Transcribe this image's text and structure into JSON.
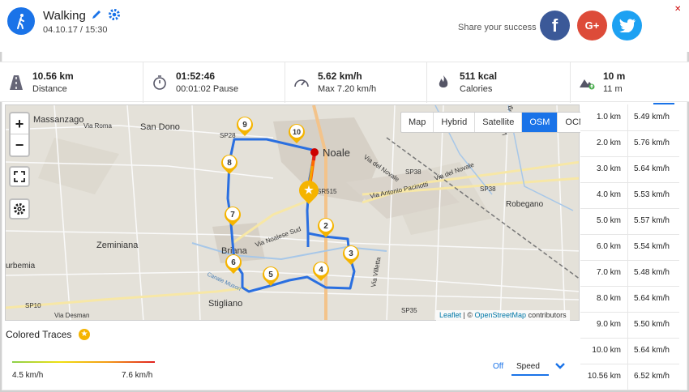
{
  "header": {
    "activity": "Walking",
    "datetime": "04.10.17 / 15:30",
    "share_label": "Share your success",
    "social": {
      "facebook": "f",
      "google": "G+",
      "twitter": "twitter-icon"
    }
  },
  "stats": [
    {
      "value": "10.56 km",
      "label": "Distance",
      "icon": "road-icon"
    },
    {
      "value": "01:52:46",
      "label": "00:01:02 Pause",
      "icon": "stopwatch-icon"
    },
    {
      "value": "5.62 km/h",
      "label": "Max 7.20 km/h",
      "icon": "speedometer-icon"
    },
    {
      "value": "511 kcal",
      "label": "Calories",
      "icon": "flame-icon"
    },
    {
      "value": "10 m",
      "label": "11 m",
      "icon": "mountain-icon"
    }
  ],
  "map": {
    "zoom_in": "+",
    "zoom_out": "−",
    "layers": [
      "Map",
      "Hybrid",
      "Satellite",
      "OSM",
      "OCM"
    ],
    "active_layer": "OSM",
    "attribution": {
      "leaflet": "Leaflet",
      "sep": " | © ",
      "osm": "OpenStreetMap",
      "tail": " contributors"
    },
    "places": [
      "Massanzago",
      "Via Roma",
      "San Dono",
      "SP28",
      "Noale",
      "Via del Novale",
      "SP38",
      "Via del Novale",
      "Via Antonio Pacinotti",
      "SP38",
      "SR515",
      "Robegano",
      "Zeminiana",
      "Briana",
      "Via Noalese Sud",
      "Canale Muson",
      "Stigliano",
      "SP10",
      "Via Desman",
      "SP35",
      "Via Valsugana",
      "Via Villetta",
      "urbemia"
    ],
    "markers": [
      "2",
      "3",
      "4",
      "5",
      "6",
      "7",
      "8",
      "9",
      "10"
    ]
  },
  "traces": {
    "title": "Colored Traces",
    "min": "4.5 km/h",
    "max": "7.6 km/h",
    "off": "Off",
    "metric": "Speed"
  },
  "splits": [
    {
      "distance": "1.0 km",
      "speed": "5.49 km/h"
    },
    {
      "distance": "2.0 km",
      "speed": "5.76 km/h"
    },
    {
      "distance": "3.0 km",
      "speed": "5.64 km/h"
    },
    {
      "distance": "4.0 km",
      "speed": "5.53 km/h"
    },
    {
      "distance": "5.0 km",
      "speed": "5.57 km/h"
    },
    {
      "distance": "6.0 km",
      "speed": "5.54 km/h"
    },
    {
      "distance": "7.0 km",
      "speed": "5.48 km/h"
    },
    {
      "distance": "8.0 km",
      "speed": "5.64 km/h"
    },
    {
      "distance": "9.0 km",
      "speed": "5.50 km/h"
    },
    {
      "distance": "10.0 km",
      "speed": "5.64 km/h"
    },
    {
      "distance": "10.56 km",
      "speed": "6.52 km/h"
    }
  ],
  "colors": {
    "accent": "#1a73e8",
    "route": "#2a6fe0",
    "marker": "#f5b400"
  }
}
